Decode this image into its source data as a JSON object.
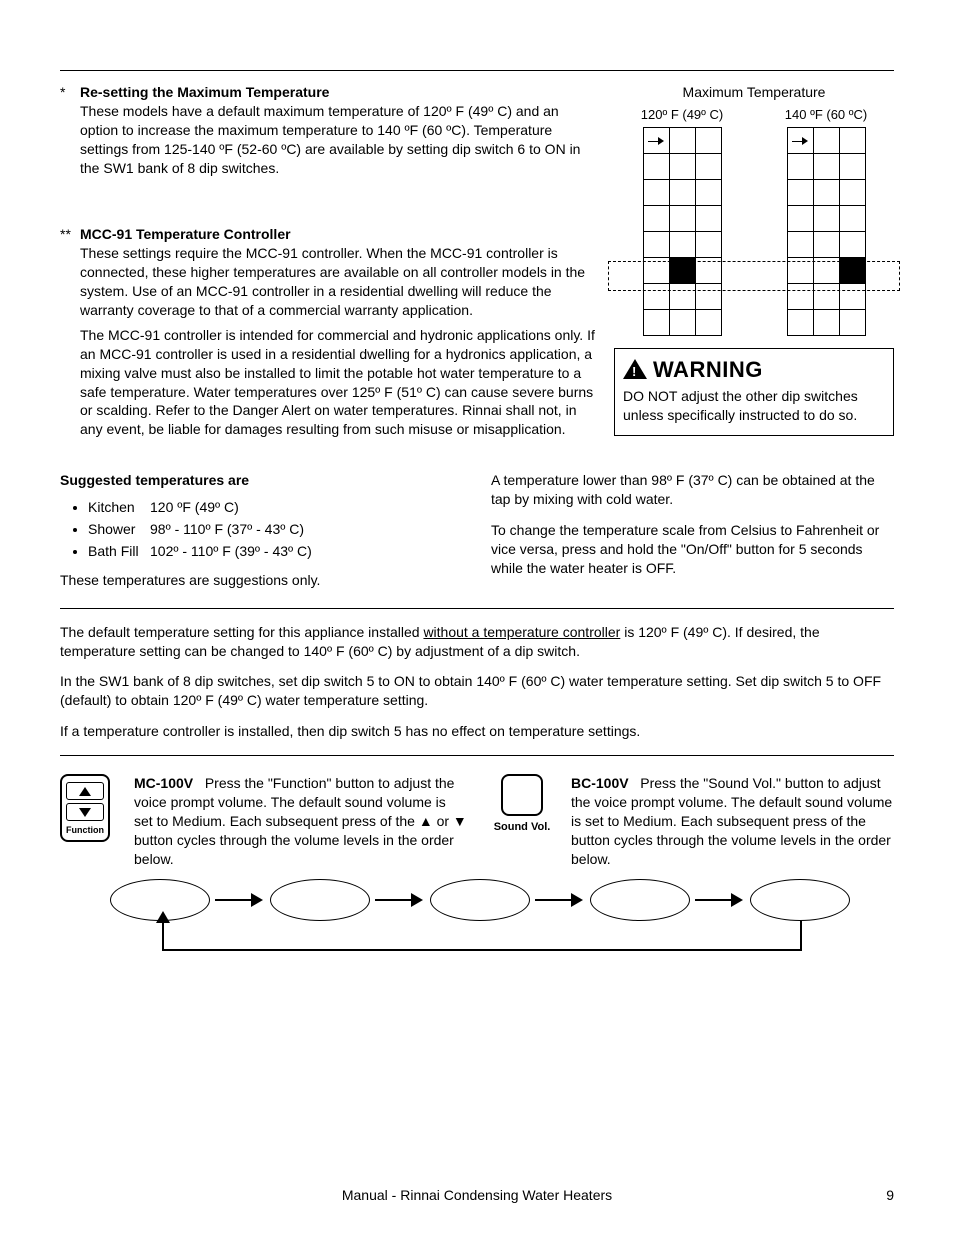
{
  "section1": {
    "aster": "*",
    "title": "Re-setting the Maximum Temperature",
    "body": "These models have a default maximum temperature of 120º F (49º C) and an option to increase the maximum temperature to 140 ºF (60 ºC). Temperature settings from 125-140 ºF (52-60 ºC) are available by setting dip switch 6 to ON in the SW1 bank of 8 dip switches."
  },
  "section2": {
    "aster": "**",
    "title": "MCC-91 Temperature Controller",
    "body1": "These settings require the MCC-91 controller.  When the MCC-91 controller is connected, these higher temperatures are available on all controller models in the system. Use of an MCC-91 controller in a residential dwelling will reduce the warranty coverage to that of a commercial warranty application.",
    "body2": "The MCC-91 controller is intended for commercial and hydronic applications only. If an MCC-91 controller is used in a residential dwelling for a hydronics application, a mixing valve must also be installed to limit the potable hot water temperature to a safe temperature. Water temperatures over 125º F (51º C) can cause severe burns or scalding. Refer to the Danger Alert on water temperatures. Rinnai shall not, in any event, be liable for damages resulting from such misuse or misapplication."
  },
  "dip": {
    "title": "Maximum Temperature",
    "left_label": "120º F (49º C)",
    "right_label": "140 ºF (60 ºC)"
  },
  "warning": {
    "label": "WARNING",
    "body": "DO NOT adjust the other dip switches unless specifically instructed to do so."
  },
  "suggested": {
    "title": "Suggested temperatures are",
    "items": [
      {
        "label": "Kitchen",
        "value": "120 ºF (49º C)"
      },
      {
        "label": "Shower",
        "value": "98º - 110º F (37º - 43º C)"
      },
      {
        "label": "Bath Fill",
        "value": "102º - 110º F (39º - 43º C)"
      }
    ],
    "note": "These temperatures are suggestions only."
  },
  "right_notes": {
    "p1": "A temperature lower than 98º F (37º C) can be obtained at the tap by mixing with cold water.",
    "p2": "To change the temperature scale from Celsius to Fahrenheit or vice versa, press and hold the \"On/Off\" button for 5 seconds while the water heater is OFF."
  },
  "default_section": {
    "p1a": "The default temperature setting for this appliance installed ",
    "p1u": "without a temperature controller",
    "p1b": " is 120º F (49º C).  If desired, the temperature setting can be changed to 140º F (60º C) by adjustment of a dip switch.",
    "p2": "In the SW1 bank of 8 dip switches, set dip switch 5 to ON to obtain 140º F (60º C) water temperature setting.  Set dip switch 5 to OFF (default) to obtain 120º F (49º C) water temperature setting.",
    "p3": "If a temperature controller is installed, then dip switch 5 has no effect on temperature settings."
  },
  "controllers": {
    "mc": {
      "title": "MC-100V",
      "body": "Press the \"Function\" button to adjust the voice prompt volume.  The default sound volume is set to Medium.  Each subsequent press of the ▲ or ▼ button cycles through the volume levels in the order below.",
      "func_label": "Function"
    },
    "bc": {
      "title": "BC-100V",
      "body": "Press the \"Sound Vol.\" button to adjust the voice prompt volume.  The default sound volume is set to Medium.  Each subsequent press of the button cycles through the volume levels in the order below.",
      "sv_label": "Sound Vol."
    }
  },
  "footer": {
    "center": "Manual - Rinnai Condensing Water Heaters",
    "page": "9"
  }
}
